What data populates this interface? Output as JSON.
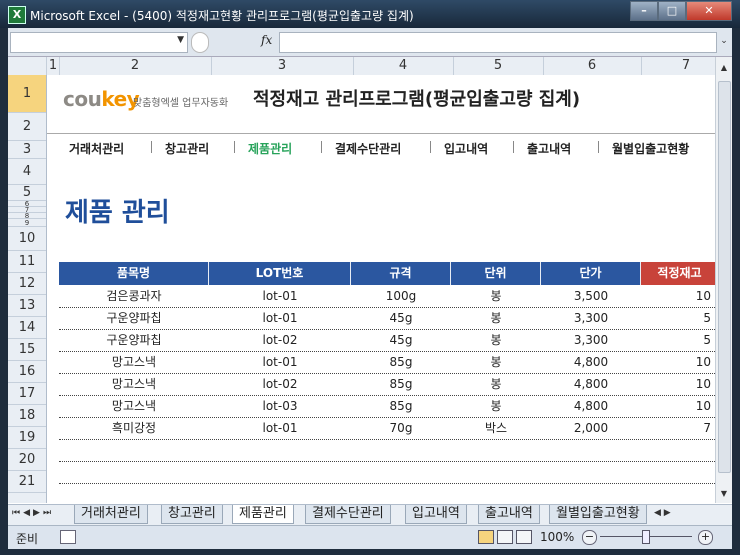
{
  "window": {
    "title": "Microsoft Excel - (5400) 적정재고현황 관리프로그램(평균입출고량 집계)",
    "app_icon": "X"
  },
  "formula_bar": {
    "name_box": "",
    "formula": "",
    "fx_label": "fx"
  },
  "columns": [
    "1",
    "2",
    "3",
    "4",
    "5",
    "6",
    "7"
  ],
  "rows": [
    "1",
    "2",
    "3",
    "4",
    "5",
    "6",
    "7",
    "8",
    "9",
    "10",
    "11",
    "12",
    "13",
    "14",
    "15",
    "16",
    "17",
    "18",
    "19",
    "20",
    "21"
  ],
  "header": {
    "logo_cou": "cou",
    "logo_key": "key",
    "tagline": "맞춤형엑셀 업무자동화",
    "app_title": "적정재고 관리프로그램(평균입출고량 집계)"
  },
  "nav": [
    "거래처관리",
    "창고관리",
    "제품관리",
    "결제수단관리",
    "입고내역",
    "출고내역",
    "월별입출고현황"
  ],
  "nav_active_index": 2,
  "page_title": "제품 관리",
  "table": {
    "headers": [
      "품목명",
      "LOT번호",
      "규격",
      "단위",
      "단가",
      "적정재고"
    ],
    "rows": [
      [
        "검은콩과자",
        "lot-01",
        "100g",
        "봉",
        "3,500",
        "10"
      ],
      [
        "구운양파칩",
        "lot-01",
        "45g",
        "봉",
        "3,300",
        "5"
      ],
      [
        "구운양파칩",
        "lot-02",
        "45g",
        "봉",
        "3,300",
        "5"
      ],
      [
        "망고스낵",
        "lot-01",
        "85g",
        "봉",
        "4,800",
        "10"
      ],
      [
        "망고스낵",
        "lot-02",
        "85g",
        "봉",
        "4,800",
        "10"
      ],
      [
        "망고스낵",
        "lot-03",
        "85g",
        "봉",
        "4,800",
        "10"
      ],
      [
        "흑미강정",
        "lot-01",
        "70g",
        "박스",
        "2,000",
        "7"
      ]
    ]
  },
  "sheet_tabs": [
    "거래처관리",
    "창고관리",
    "제품관리",
    "결제수단관리",
    "입고내역",
    "출고내역",
    "월별입출고현황"
  ],
  "active_sheet_index": 2,
  "status": {
    "ready": "준비",
    "zoom": "100%"
  },
  "colors": {
    "header_blue": "#2b57a0",
    "header_red": "#c8433a",
    "title_blue": "#1f4e9a",
    "active_nav": "#27a35a",
    "logo_orange": "#f29400"
  }
}
